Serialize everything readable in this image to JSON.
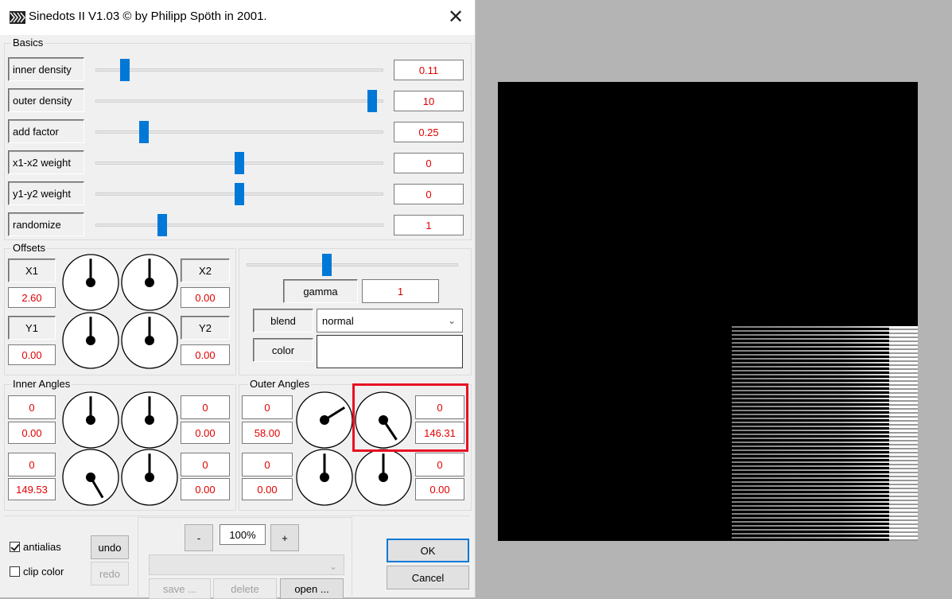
{
  "window": {
    "title": "Sinedots II V1.03 © by Philipp Spöth in 2001.",
    "close_glyph": "✕"
  },
  "basics": {
    "label": "Basics",
    "rows": [
      {
        "name": "inner-density",
        "label": "inner density",
        "value": "0.11",
        "slider_fraction": 0.07
      },
      {
        "name": "outer-density",
        "label": "outer density",
        "value": "10",
        "slider_fraction": 1.0
      },
      {
        "name": "add-factor",
        "label": "add factor",
        "value": "0.25",
        "slider_fraction": 0.14
      },
      {
        "name": "x1-x2-weight",
        "label": "x1-x2 weight",
        "value": "0",
        "slider_fraction": 0.5
      },
      {
        "name": "y1-y2-weight",
        "label": "y1-y2 weight",
        "value": "0",
        "slider_fraction": 0.5
      },
      {
        "name": "randomize",
        "label": "randomize",
        "value": "1",
        "slider_fraction": 0.21
      }
    ]
  },
  "offsets": {
    "label": "Offsets",
    "x1_label": "X1",
    "x1_value": "2.60",
    "x2_label": "X2",
    "x2_value": "0.00",
    "y1_label": "Y1",
    "y1_value": "0.00",
    "y2_label": "Y2",
    "y2_value": "0.00"
  },
  "render": {
    "gamma_label": "gamma",
    "gamma_value": "1",
    "gamma_slider_fraction": 0.37,
    "blend_label": "blend",
    "blend_selected": "normal",
    "color_label": "color"
  },
  "inner_angles": {
    "label": "Inner Angles",
    "tl_top": "0",
    "tl_bottom": "0.00",
    "tr_top": "0",
    "tr_bottom": "0.00",
    "bl_top": "0",
    "bl_bottom": "149.53",
    "br_top": "0",
    "br_bottom": "0.00"
  },
  "outer_angles": {
    "label": "Outer Angles",
    "tl_top": "0",
    "tl_bottom": "58.00",
    "tr_top": "0",
    "tr_bottom": "146.31",
    "bl_top": "0",
    "bl_bottom": "0.00",
    "br_top": "0",
    "br_bottom": "0.00"
  },
  "bottom": {
    "antialias_label": "antialias",
    "antialias_checked": true,
    "clip_color_label": "clip color",
    "clip_color_checked": false,
    "undo_label": "undo",
    "redo_label": "redo",
    "zoom_minus": "-",
    "zoom_value": "100%",
    "zoom_plus": "+",
    "save_label": "save ...",
    "delete_label": "delete",
    "open_label": "open ...",
    "ok_label": "OK",
    "cancel_label": "Cancel"
  },
  "colors": {
    "accent": "#0078d7",
    "value_text": "#e00000",
    "highlight": "#e81123",
    "preview_bg": "#000000"
  }
}
